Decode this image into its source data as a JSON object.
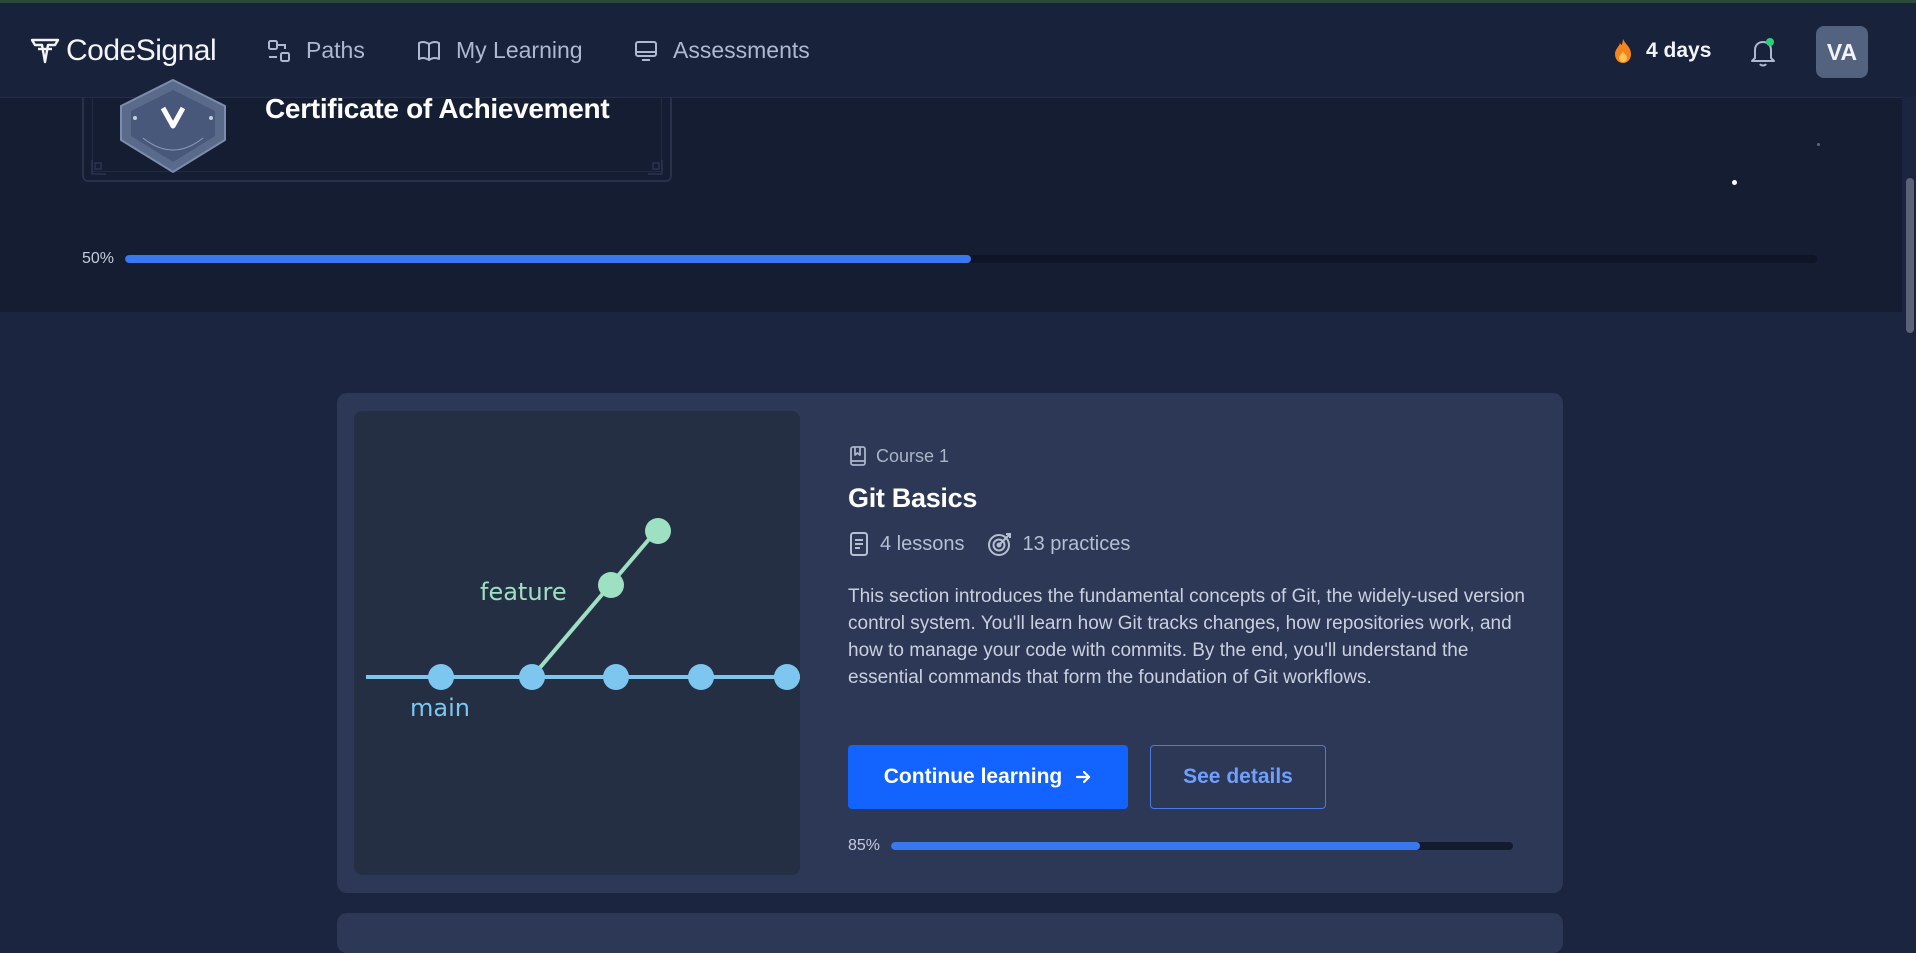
{
  "app": {
    "brand": "CodeSignal"
  },
  "nav": {
    "paths": "Paths",
    "my_learning": "My Learning",
    "assessments": "Assessments"
  },
  "header": {
    "streak": "4 days",
    "avatar_initials": "VA"
  },
  "path": {
    "certificate_title": "Certificate of Achievement",
    "progress_label": "50%",
    "progress": 0.5
  },
  "course": {
    "label": "Course 1",
    "title": "Git Basics",
    "lessons": "4 lessons",
    "practices": "13 practices",
    "description": "This section introduces the fundamental concepts of Git, the widely-used version control system. You'll learn how Git tracks changes, how repositories work, and how to manage your code with commits. By the end, you'll understand the essential commands that form the foundation of Git workflows.",
    "continue_label": "Continue learning",
    "details_label": "See details",
    "progress_label": "85%",
    "progress": 0.85,
    "diagram": {
      "branch_label": "feature",
      "main_label": "main"
    }
  },
  "colors": {
    "accent": "#1263ff",
    "progress": "#3a78f0",
    "branch_main": "#7cc6f0",
    "branch_feature": "#9ee0c2"
  }
}
